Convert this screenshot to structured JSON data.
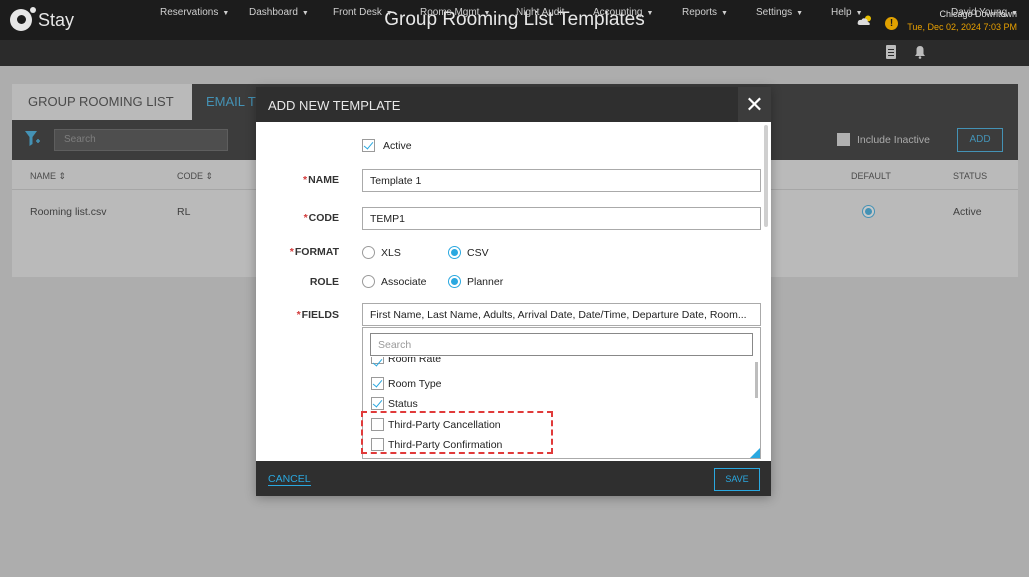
{
  "app": {
    "logo_text": "Stay",
    "title": "Group Rooming List Templates",
    "location": "Chicago Downtown",
    "datetime": "Tue, Dec 02, 2024 7:03 PM",
    "alert_symbol": "!"
  },
  "nav": {
    "items": [
      {
        "label": "Reservations",
        "dropdown": true
      },
      {
        "label": "Dashboard",
        "dropdown": true
      },
      {
        "label": "Front Desk",
        "dropdown": true
      },
      {
        "label": "Rooms Mgmt",
        "dropdown": true
      },
      {
        "label": "Night Audit",
        "dropdown": false
      },
      {
        "label": "Accounting",
        "dropdown": true
      },
      {
        "label": "Reports",
        "dropdown": true
      },
      {
        "label": "Settings",
        "dropdown": true
      },
      {
        "label": "Help",
        "dropdown": true
      }
    ],
    "user": "David Young",
    "caret": "▼"
  },
  "page": {
    "tabs": [
      {
        "label": "GROUP ROOMING LIST"
      },
      {
        "label": "EMAIL T"
      }
    ],
    "search_placeholder": "Search",
    "include_inactive_label": "Include Inactive",
    "add_label": "ADD",
    "columns": {
      "name": "NAME ⇕",
      "code": "CODE ⇕",
      "default": "DEFAULT",
      "status": "STATUS"
    },
    "rows": [
      {
        "name": "Rooming list.csv",
        "code": "RL",
        "default": true,
        "status": "Active"
      }
    ]
  },
  "modal": {
    "title": "ADD NEW TEMPLATE",
    "close_symbol": "✕",
    "active_label": "Active",
    "active_checked": true,
    "required_mark": "*",
    "name_label": "NAME",
    "name_value": "Template 1",
    "code_label": "CODE",
    "code_value": "TEMP1",
    "format_label": "FORMAT",
    "format_options": [
      "XLS",
      "CSV"
    ],
    "format_selected": "CSV",
    "role_label": "ROLE",
    "role_options": [
      "Associate",
      "Planner"
    ],
    "role_selected": "Planner",
    "fields_label": "FIELDS",
    "fields_value": "First Name, Last Name, Adults, Arrival Date, Date/Time, Departure Date, Room...",
    "fields_search_placeholder": "Search",
    "field_items": [
      {
        "label": "Room Rate",
        "checked": true
      },
      {
        "label": "Room Type",
        "checked": true
      },
      {
        "label": "Status",
        "checked": true
      },
      {
        "label": "Third-Party Cancellation",
        "checked": false
      },
      {
        "label": "Third-Party Confirmation",
        "checked": false
      }
    ],
    "cancel_label": "CANCEL",
    "save_label": "SAVE"
  },
  "colors": {
    "accent": "#2aa8e0",
    "topbar": "#1c1c1c",
    "highlight": "#e03a3a",
    "datetime": "#e8a000"
  }
}
